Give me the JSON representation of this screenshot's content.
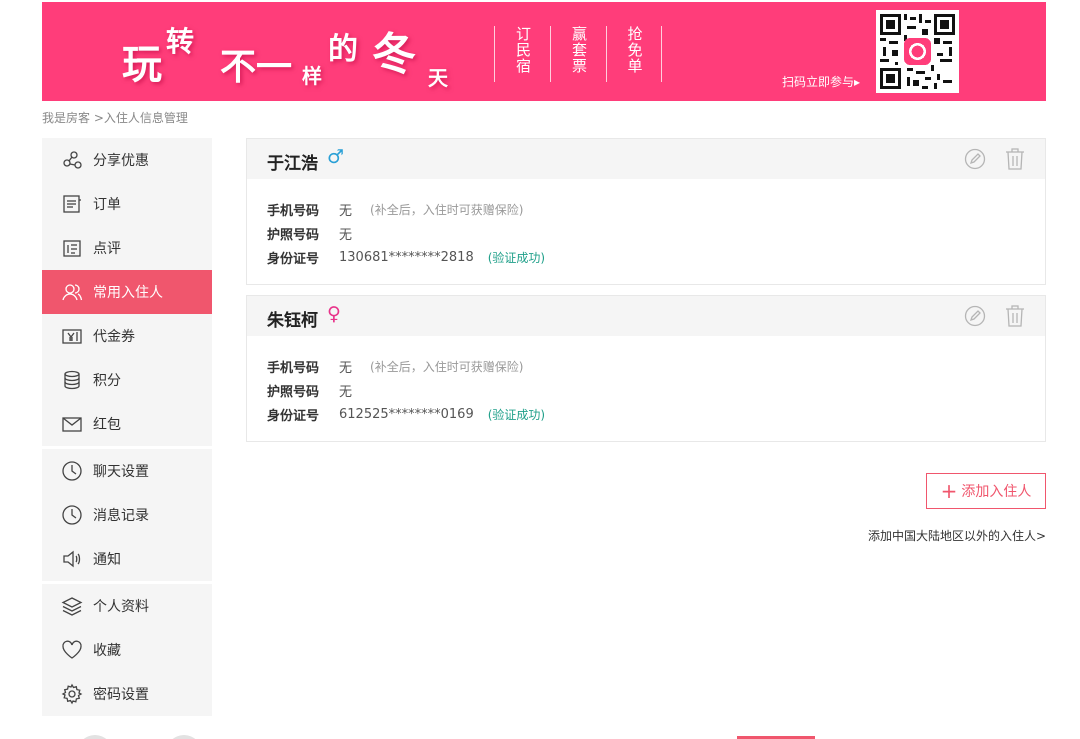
{
  "banner": {
    "slogan": [
      "玩",
      "转",
      "不一",
      "样",
      "的",
      "冬",
      "天"
    ],
    "promos": [
      "订民宿",
      "赢套票",
      "抢免单"
    ],
    "scan_text": "扫码立即参与▸",
    "bg_color": "#ff3d7a"
  },
  "breadcrumb": "我是房客 >入住人信息管理",
  "sidebar": {
    "groups": [
      [
        {
          "label": "分享优惠",
          "icon": "share-icon"
        },
        {
          "label": "订单",
          "icon": "order-icon"
        },
        {
          "label": "点评",
          "icon": "review-icon"
        },
        {
          "label": "常用入住人",
          "icon": "guests-icon",
          "active": true
        },
        {
          "label": "代金券",
          "icon": "voucher-icon"
        },
        {
          "label": "积分",
          "icon": "points-icon"
        },
        {
          "label": "红包",
          "icon": "envelope-icon"
        }
      ],
      [
        {
          "label": "聊天设置",
          "icon": "clock-icon"
        },
        {
          "label": "消息记录",
          "icon": "clock-icon"
        },
        {
          "label": "通知",
          "icon": "speaker-icon"
        }
      ],
      [
        {
          "label": "个人资料",
          "icon": "layers-icon"
        },
        {
          "label": "收藏",
          "icon": "heart-icon"
        },
        {
          "label": "密码设置",
          "icon": "gear-icon"
        }
      ]
    ],
    "active_color": "#f0566d"
  },
  "guests": [
    {
      "name": "于江浩",
      "gender_symbol": "♂",
      "phone_label": "手机号码",
      "phone": "无",
      "phone_note": "(补全后，入住时可获赠保险)",
      "passport_label": "护照号码",
      "passport": "无",
      "id_label": "身份证号",
      "id": "130681********2818",
      "id_status": "(验证成功)"
    },
    {
      "name": "朱钰柯",
      "gender_symbol": "♀",
      "phone_label": "手机号码",
      "phone": "无",
      "phone_note": "(补全后，入住时可获赠保险)",
      "passport_label": "护照号码",
      "passport": "无",
      "id_label": "身份证号",
      "id": "612525********0169",
      "id_status": "(验证成功)"
    }
  ],
  "actions": {
    "add_guest": "添加入住人",
    "add_foreign": "添加中国大陆地区以外的入住人>"
  }
}
